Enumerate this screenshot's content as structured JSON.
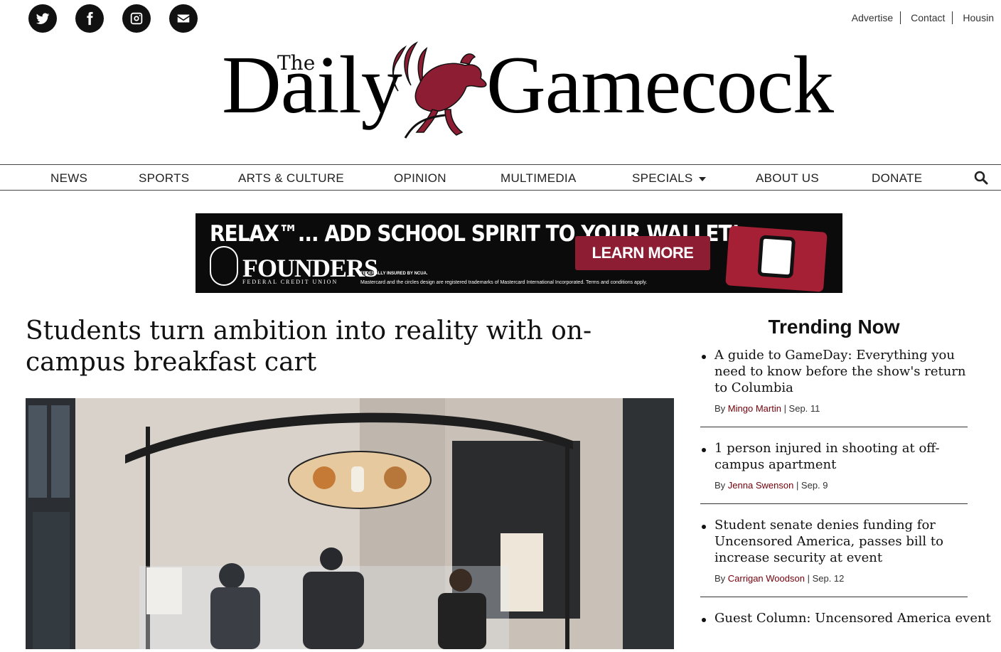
{
  "social": [
    {
      "name": "twitter-icon"
    },
    {
      "name": "facebook-icon"
    },
    {
      "name": "instagram-icon"
    },
    {
      "name": "email-icon"
    }
  ],
  "utility_links": [
    "Advertise",
    "Contact",
    "Housin"
  ],
  "masthead": {
    "the": "The",
    "word1": "Daily",
    "word2": "Gamecock",
    "accent_color": "#8c1d33"
  },
  "nav": {
    "items": [
      "NEWS",
      "SPORTS",
      "ARTS & CULTURE",
      "OPINION",
      "MULTIMEDIA",
      "SPECIALS",
      "ABOUT US",
      "DONATE"
    ],
    "search_icon": "search-icon"
  },
  "ad": {
    "headline": "RELAX™... ADD SCHOOL SPIRIT TO YOUR WALLET!",
    "brand": "FOUNDERS",
    "brand_sub": "FEDERAL CREDIT UNION",
    "fine_print_1": "FEDERALLY INSURED BY NCUA.",
    "fine_print_2": "Mastercard and the circles design are registered trademarks of Mastercard International Incorporated.  Terms and conditions apply.",
    "cta": "LEARN MORE",
    "card_label": "FOUNDERS"
  },
  "article": {
    "title": "Students turn ambition into reality with on-campus breakfast cart"
  },
  "trending": {
    "title": "Trending Now",
    "items": [
      {
        "headline": "A guide to GameDay: Everything you need to know before the show's return to Columbia",
        "by": "By",
        "author": "Mingo Martin",
        "date": "| Sep. 11"
      },
      {
        "headline": "1 person injured in shooting at off-campus apartment",
        "by": "By",
        "author": "Jenna Swenson",
        "date": "| Sep. 9"
      },
      {
        "headline": "Student senate denies funding for Uncensored America, passes bill to increase security at event",
        "by": "By",
        "author": "Carrigan Woodson",
        "date": "| Sep. 12"
      },
      {
        "headline": "Guest Column: Uncensored America event",
        "by": "",
        "author": "",
        "date": ""
      }
    ]
  }
}
